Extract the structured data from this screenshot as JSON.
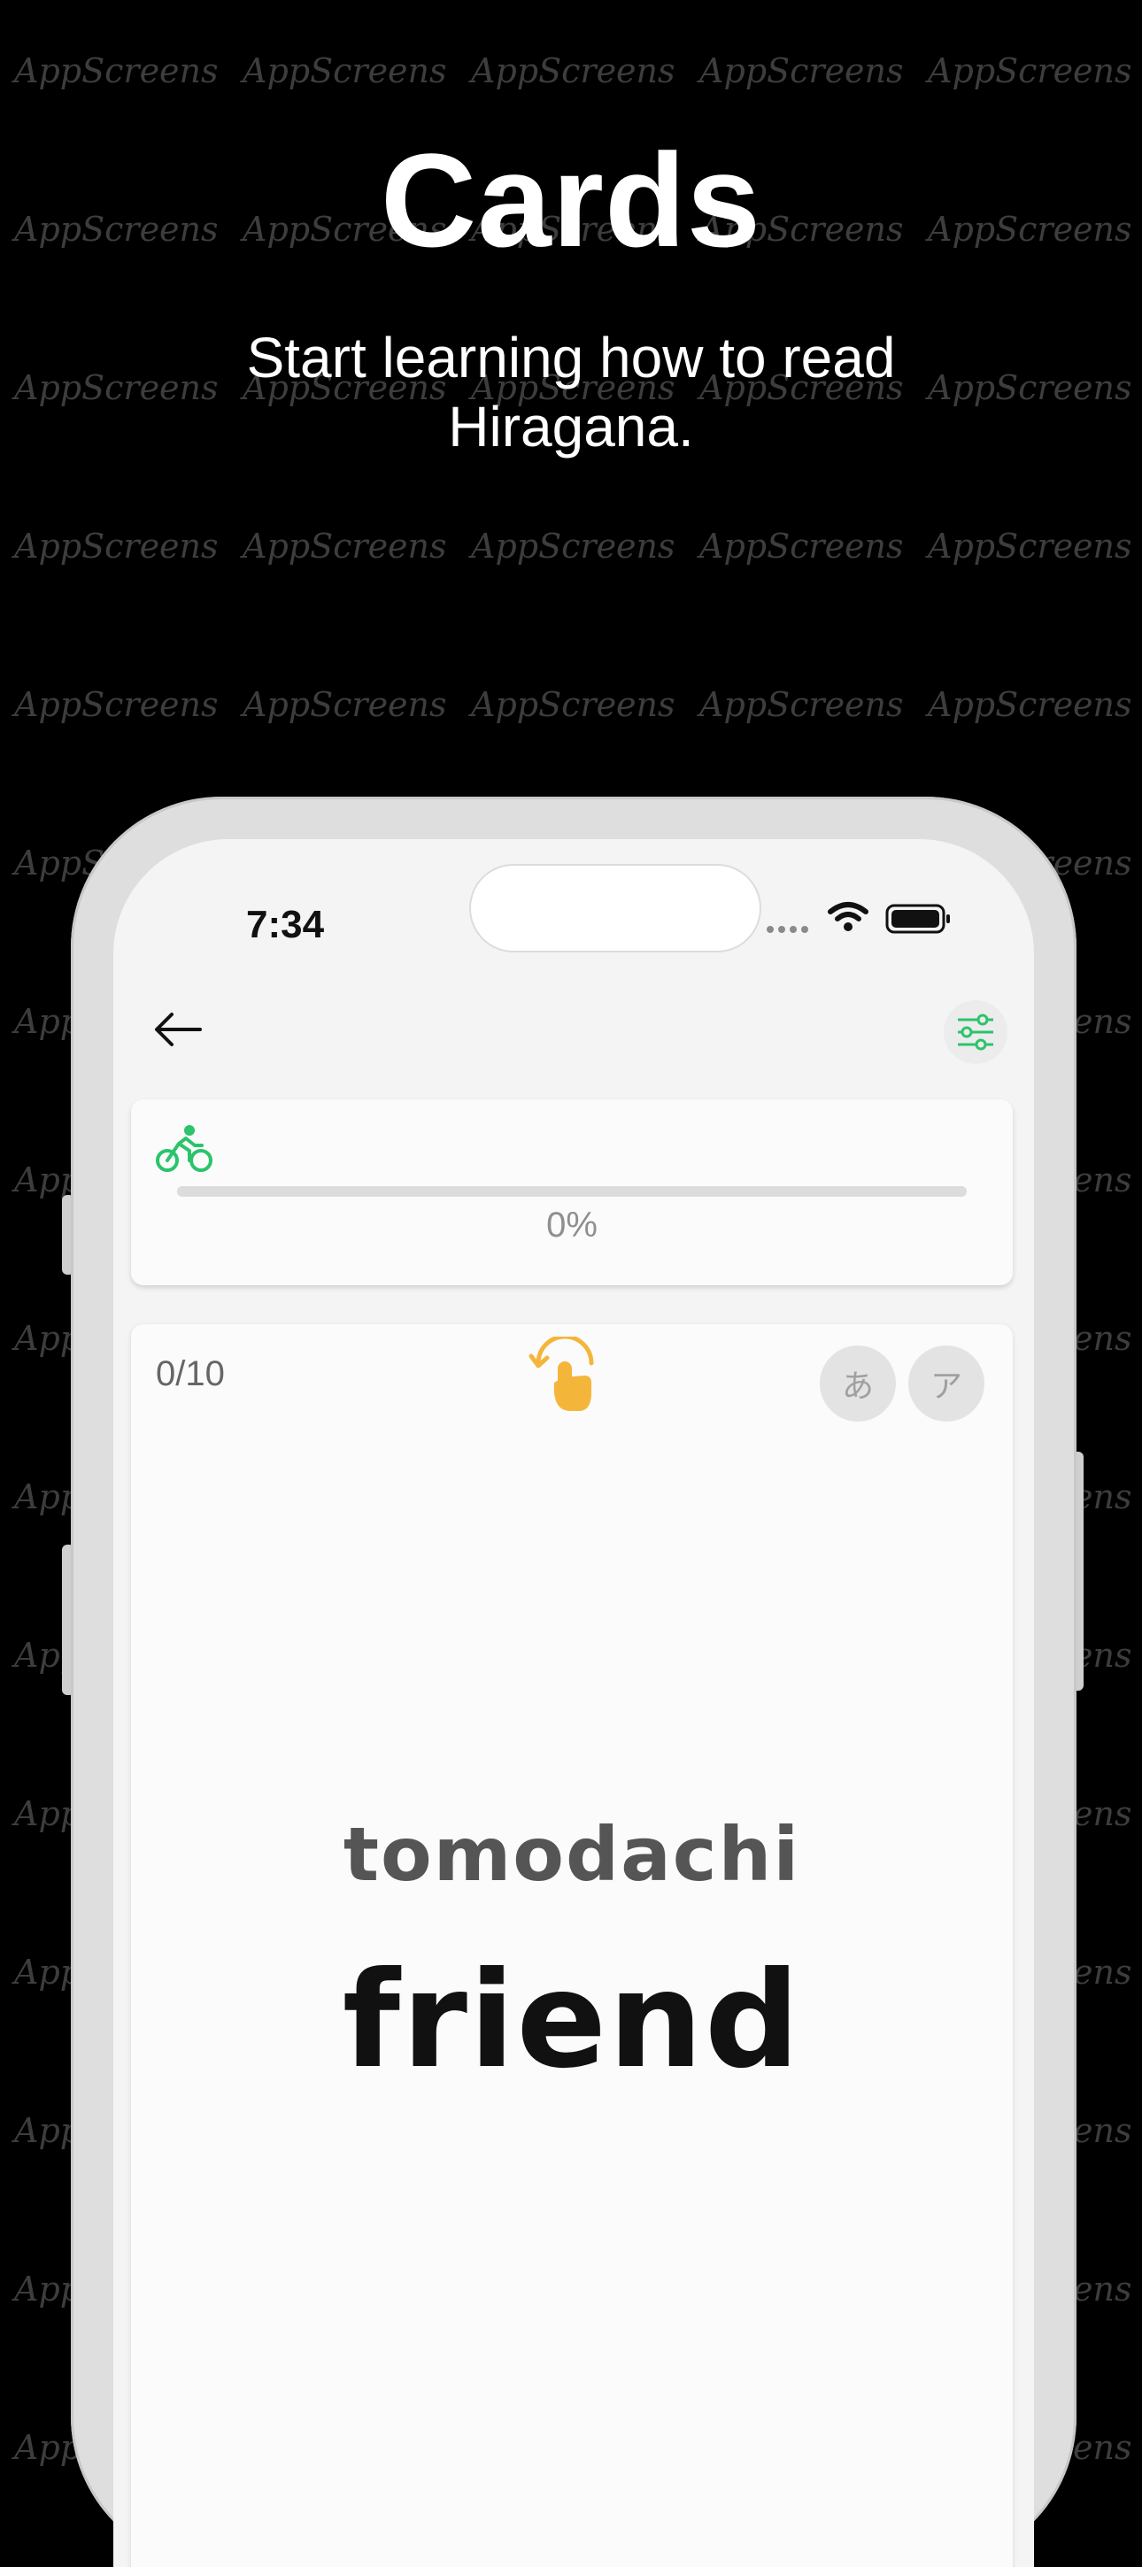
{
  "promo": {
    "title": "Cards",
    "subtitle": "Start learning how to read Hiragana."
  },
  "watermark": {
    "text": "AppScreens"
  },
  "status_bar": {
    "time": "7:34"
  },
  "progress": {
    "label": "0%",
    "fraction": 0
  },
  "card": {
    "counter": "0/10",
    "hiragana_toggle": "あ",
    "katakana_toggle": "ア",
    "romaji": "tomodachi",
    "meaning": "friend"
  },
  "colors": {
    "accent_green": "#2bc46b",
    "hand_yellow": "#f4b63a",
    "background": "#000000"
  },
  "icons": [
    "back-arrow-icon",
    "filter-sliders-icon",
    "bicycle-icon",
    "tap-flip-icon",
    "wifi-icon",
    "battery-icon"
  ]
}
